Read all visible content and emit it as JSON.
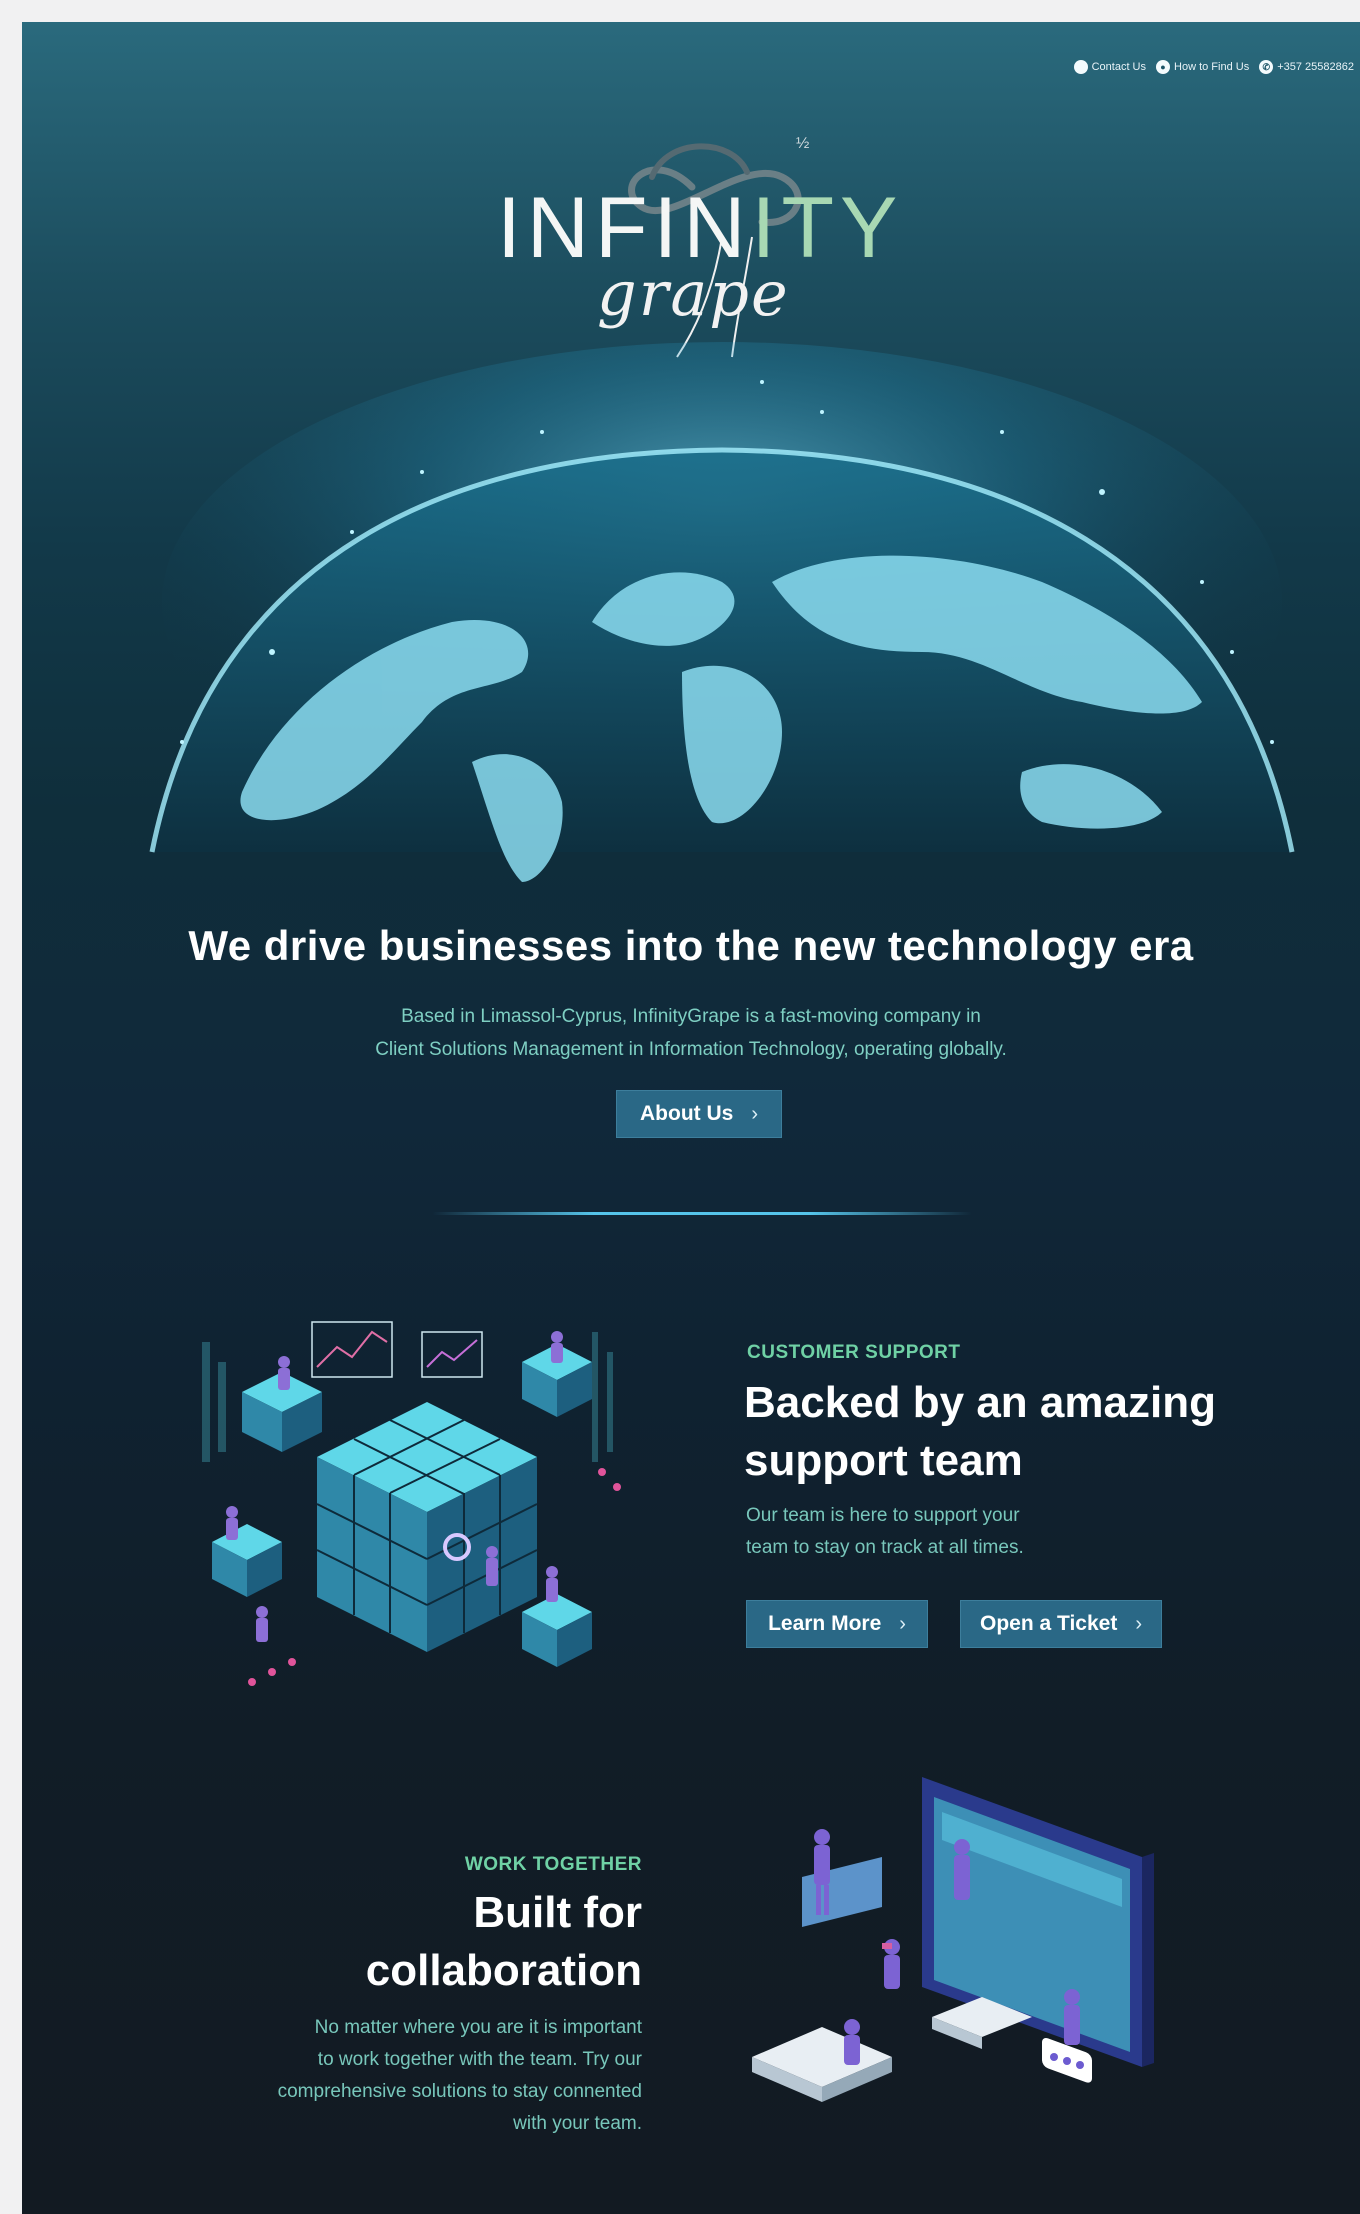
{
  "topbar": {
    "contact": "Contact Us",
    "find": "How to Find Us",
    "phone": "+357 25582862"
  },
  "logo": {
    "word_white": "INFIN",
    "word_green": "ITY",
    "script": "grape",
    "sup": "½"
  },
  "hero": {
    "title": "We drive businesses into the new technology era",
    "desc_line1": "Based in Limassol-Cyprus, InfinityGrape is a fast-moving company in",
    "desc_line2": "Client Solutions Management in Information Technology, operating globally.",
    "about_label": "About Us"
  },
  "support": {
    "eyebrow": "CUSTOMER SUPPORT",
    "title_line1": "Backed by an amazing",
    "title_line2": "support team",
    "desc_line1": "Our team is here to support your",
    "desc_line2": "team to stay on track at all times.",
    "learn_label": "Learn More",
    "ticket_label": "Open a Ticket"
  },
  "collab": {
    "eyebrow": "WORK TOGETHER",
    "title_line1": "Built for",
    "title_line2": "collaboration",
    "desc_line1": "No matter where you are it is important",
    "desc_line2": "to work together with the team. Try our",
    "desc_line3": "comprehensive solutions to stay connented",
    "desc_line4": "with your team."
  },
  "icons": {
    "contact": "contact-icon",
    "location": "location-pin-icon",
    "phone": "phone-icon",
    "chevron": "chevron-right-icon"
  },
  "colors": {
    "accent_green": "#6fd1a5",
    "button_blue": "#2a6886",
    "desc_teal": "#78c7bb",
    "divider_glow": "#55c4ea"
  }
}
